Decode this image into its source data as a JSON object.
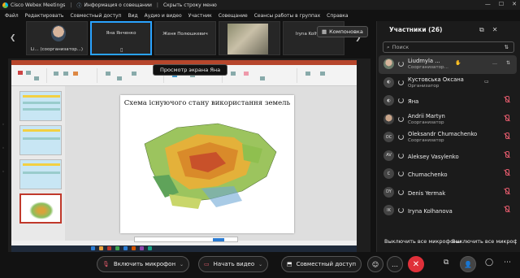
{
  "titlebar": {
    "app_title": "Cisco Webex Meetings",
    "meeting_info": "Информация о совещании",
    "hide_menu": "Скрыть строку меню"
  },
  "menu": [
    "Файл",
    "Редактировать",
    "Совместный доступ",
    "Вид",
    "Аудио и видео",
    "Участник",
    "Совещание",
    "Сеансы работы в группах",
    "Справка"
  ],
  "thumbnails": [
    {
      "name": "Li...  (соорганизатор...)"
    },
    {
      "name": "Яна Янченко"
    },
    {
      "name": "Женя Полюшкевич"
    },
    {
      "name": ""
    },
    {
      "name": "Iryna Kolhanova"
    }
  ],
  "layout_button": "Компоновка",
  "share_banner": "Просмотр экрана Яна",
  "slide": {
    "title": "Схема існуючого стану використання земель"
  },
  "panel": {
    "title": "Участники (26)",
    "search_placeholder": "Поиск",
    "participants": [
      {
        "name": "Liudmyla ...",
        "role": "Соорганизатор...",
        "initials": "",
        "highlight": true
      },
      {
        "name": "Кустовська Оксана",
        "role": "Организатор",
        "initials": ""
      },
      {
        "name": "Яна",
        "role": "",
        "initials": ""
      },
      {
        "name": "Andrii Martyn",
        "role": "Соорганизатор",
        "initials": ""
      },
      {
        "name": "Oleksandr Chumachenko",
        "role": "Соорганизатор",
        "initials": "OC"
      },
      {
        "name": "Aleksey Vasylenko",
        "role": "",
        "initials": "AV"
      },
      {
        "name": "Chumachenko",
        "role": "",
        "initials": "C"
      },
      {
        "name": "Denis Yermak",
        "role": "",
        "initials": "DY"
      },
      {
        "name": "Iryna Kolhanova",
        "role": "",
        "initials": "IK"
      }
    ],
    "mute_all": "Выключить все микрофоны",
    "unmute_all": "Выключить все микрофоны"
  },
  "bottom": {
    "mic": "Включить микрофон",
    "video": "Начать видео",
    "share": "Совместный доступ"
  },
  "colors": {
    "accent": "#2aa3ff",
    "end_call": "#e0303a",
    "mute_red": "#e05a6b"
  }
}
